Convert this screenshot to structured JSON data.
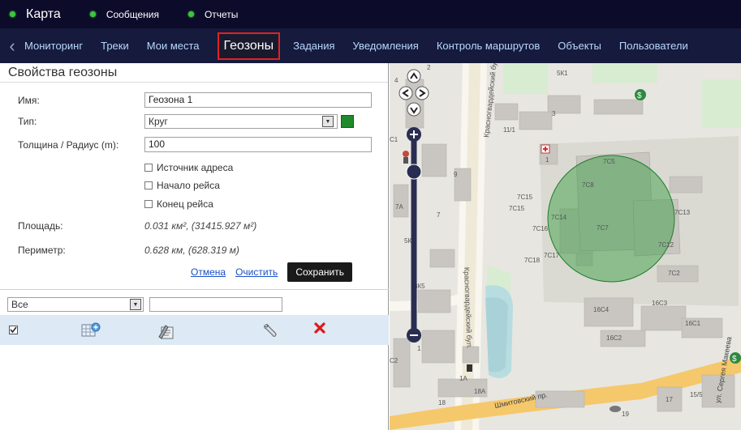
{
  "topbar": {
    "items": [
      {
        "label": "Карта"
      },
      {
        "label": "Сообщения"
      },
      {
        "label": "Отчеты"
      }
    ]
  },
  "nav": {
    "items": [
      {
        "label": "Мониторинг"
      },
      {
        "label": "Треки"
      },
      {
        "label": "Мои места"
      },
      {
        "label": "Геозоны"
      },
      {
        "label": "Задания"
      },
      {
        "label": "Уведомления"
      },
      {
        "label": "Контроль маршрутов"
      },
      {
        "label": "Объекты"
      },
      {
        "label": "Пользователи"
      }
    ],
    "active": "Геозоны"
  },
  "panel": {
    "title": "Свойства геозоны",
    "name_label": "Имя:",
    "name_value": "Геозона 1",
    "type_label": "Тип:",
    "type_value": "Круг",
    "type_color": "#1f8a2b",
    "radius_label": "Толщина / Радиус (m):",
    "radius_value": "100",
    "checks": [
      {
        "label": "Источник адреса"
      },
      {
        "label": "Начало рейса"
      },
      {
        "label": "Конец рейса"
      }
    ],
    "area_label": "Площадь:",
    "area_value": "0.031 км², (31415.927 м²)",
    "perimeter_label": "Периметр:",
    "perimeter_value": "0.628 км, (628.319 м)",
    "cancel": "Отмена",
    "clear": "Очистить",
    "save": "Сохранить"
  },
  "list": {
    "filter_value": "Все",
    "icons": [
      "geozone-edit-icon",
      "properties-icon",
      "wrench-icon",
      "delete-icon"
    ]
  },
  "map": {
    "street_labels": [
      "Красногвардейский бул.",
      "Шмитовский пр.",
      "ул. Сергея Макеева"
    ],
    "building_labels": [
      "5К1",
      "3",
      "11/1",
      "1",
      "9",
      "7",
      "7А",
      "5К",
      "3К5",
      "7С5",
      "7С8",
      "7С15",
      "7С15",
      "7С16",
      "7С14",
      "7С7",
      "7С13",
      "7С12",
      "7С18",
      "7С17",
      "7С2",
      "16С4",
      "16С3",
      "16С1",
      "16С2",
      "1А",
      "18А",
      "18",
      "17",
      "15/5",
      "19",
      "2",
      "1",
      "4",
      "C1",
      "C2"
    ],
    "geozone_color": "#2e9a3a"
  }
}
